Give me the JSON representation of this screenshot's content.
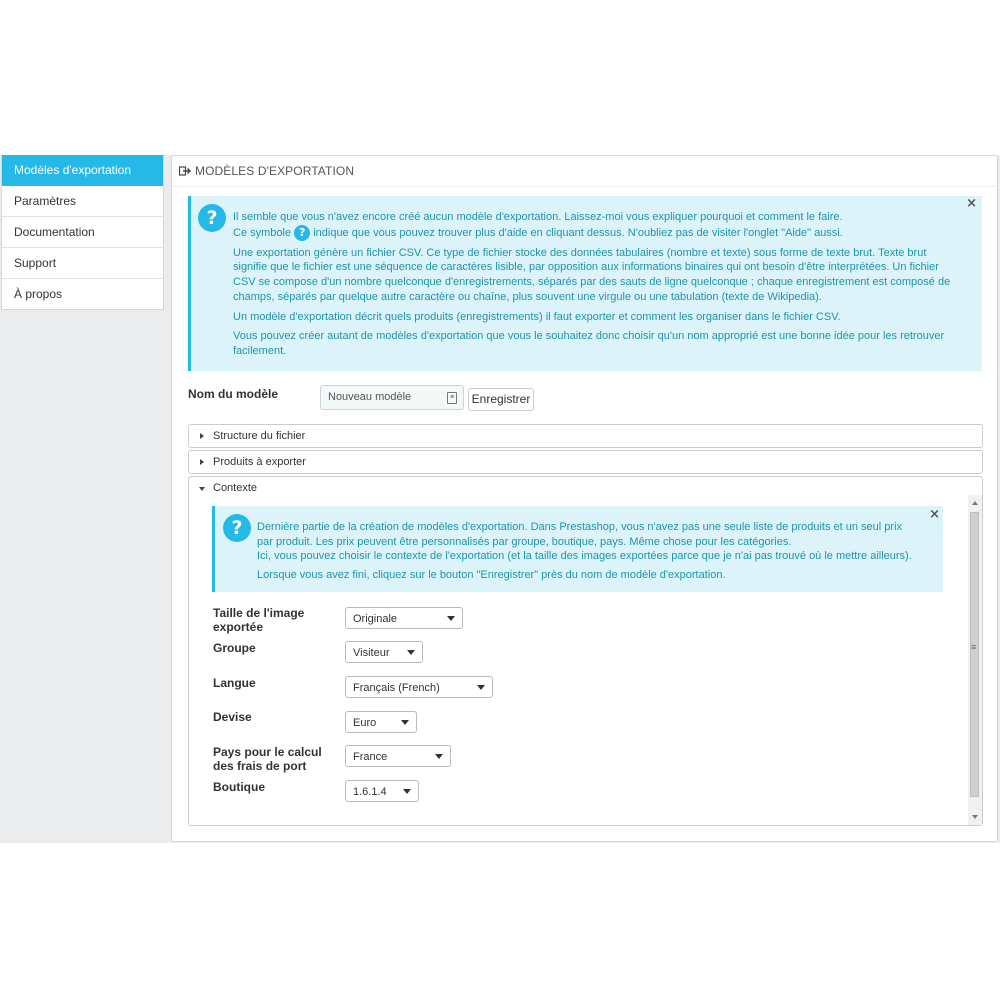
{
  "sidebar": {
    "items": [
      {
        "label": "Modèles d'exportation"
      },
      {
        "label": "Paramètres"
      },
      {
        "label": "Documentation"
      },
      {
        "label": "Support"
      },
      {
        "label": "À propos"
      }
    ]
  },
  "panel": {
    "title": "MODÈLES D'EXPORTATION"
  },
  "intro_alert": {
    "line1": "Il semble que vous n'avez encore créé aucun modèle d'exportation. Laissez-moi vous expliquer pourquoi et comment le faire.",
    "line2_before": "Ce symbole",
    "line2_after": "indique que vous pouvez trouver plus d'aide en cliquant dessus. N'oubliez pas de visiter l'onglet \"Aide\" aussi.",
    "para2": "Une exportation génère un fichier CSV. Ce type de fichier stocke des données tabulaires (nombre et texte) sous forme de texte brut. Texte brut signifie que le fichier est une séquence de caractères lisible, par opposition aux informations binaires qui ont besoin d'être interprétées. Un fichier CSV se compose d'un nombre quelconque d'enregistrements, séparés par des sauts de ligne quelconque ; chaque enregistrement est composé de champs, séparés par quelque autre caractère ou chaîne, plus souvent une virgule ou une tabulation (texte de Wikipedia).",
    "para3": "Un modèle d'exportation décrit quels produits (enregistrements) il faut exporter et comment les organiser dans le fichier CSV.",
    "para4": "Vous pouvez créer autant de modèles d'exportation que vous le souhaitez donc choisir qu'un nom approprié est une bonne idée pour les retrouver facilement.",
    "close": "×"
  },
  "model_name": {
    "label": "Nom du modèle",
    "value": "Nouveau modèle",
    "save_button": "Enregistrer"
  },
  "accordion": {
    "structure": "Structure du fichier",
    "products": "Produits à exporter",
    "context": "Contexte"
  },
  "context_alert": {
    "para1": "Dernière partie de la création de modèles d'exportation. Dans Prestashop, vous n'avez pas une seule liste de produits et un seul prix par produit. Les prix peuvent être personnalisés par groupe, boutique, pays. Même chose pour les catégories.",
    "para1b": "Ici, vous pouvez choisir le contexte de l'exportation (et la taille des images exportées parce que je n'ai pas trouvé où le mettre ailleurs).",
    "para2": "Lorsque vous avez fini, cliquez sur le bouton \"Enregistrer\" près du nom de modèle d'exportation.",
    "close": "×"
  },
  "context_form": {
    "image_size": {
      "label": "Taille de l'image exportée",
      "value": "Originale"
    },
    "group": {
      "label": "Groupe",
      "value": "Visiteur"
    },
    "language": {
      "label": "Langue",
      "value": "Français (French)"
    },
    "currency": {
      "label": "Devise",
      "value": "Euro"
    },
    "country": {
      "label": "Pays pour le calcul des frais de port",
      "value": "France"
    },
    "shop": {
      "label": "Boutique",
      "value": "1.6.1.4"
    }
  },
  "colors": {
    "accent": "#25b9e7",
    "info_bg": "#dcf4f9",
    "info_text": "#1e94ab",
    "band_bg": "#ebeced"
  }
}
